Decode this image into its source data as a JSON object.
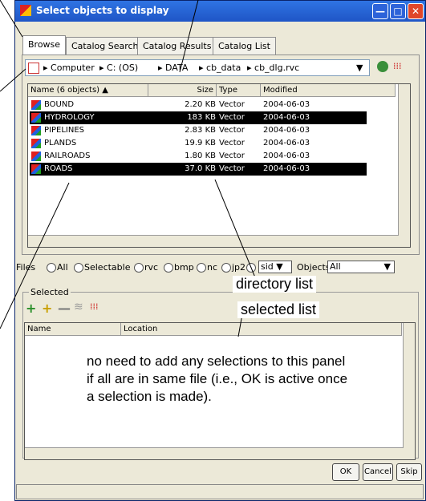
{
  "window": {
    "title": "Select objects to display",
    "buttons": {
      "minimize": "—",
      "maximize": "□",
      "close": "✕"
    }
  },
  "tabs": [
    "Browse",
    "Catalog Search",
    "Catalog Results",
    "Catalog List"
  ],
  "path": [
    "Computer",
    "C: (OS)",
    "DATA",
    "cb_data",
    "cb_dlg.rvc"
  ],
  "list": {
    "headers": [
      "Name (6 objects) ▲",
      "Size",
      "Type",
      "Modified"
    ],
    "rows": [
      {
        "name": "BOUND",
        "size": "2.20 KB",
        "type": "Vector",
        "modified": "2004-06-03",
        "selected": false
      },
      {
        "name": "HYDROLOGY",
        "size": "183 KB",
        "type": "Vector",
        "modified": "2004-06-03",
        "selected": true
      },
      {
        "name": "PIPELINES",
        "size": "2.83 KB",
        "type": "Vector",
        "modified": "2004-06-03",
        "selected": false
      },
      {
        "name": "PLANDS",
        "size": "19.9 KB",
        "type": "Vector",
        "modified": "2004-06-03",
        "selected": false
      },
      {
        "name": "RAILROADS",
        "size": "1.80 KB",
        "type": "Vector",
        "modified": "2004-06-03",
        "selected": false
      },
      {
        "name": "ROADS",
        "size": "37.0 KB",
        "type": "Vector",
        "modified": "2004-06-03",
        "selected": true
      }
    ]
  },
  "filters": {
    "files_label": "Files",
    "options": [
      "All",
      "Selectable",
      "rvc",
      "bmp",
      "nc",
      "jp2"
    ],
    "format_value": "sid",
    "objects_label": "Objects",
    "objects_value": "All"
  },
  "selected": {
    "group_label": "Selected",
    "headers": [
      "Name",
      "Location"
    ]
  },
  "buttons": {
    "ok": "OK",
    "cancel": "Cancel",
    "skip": "Skip"
  },
  "annotations": {
    "directory_list": "directory list",
    "selected_list": "selected list",
    "note": "no need to add any selections to this panel if all are in same file (i.e., OK is active once a selection is made)."
  }
}
